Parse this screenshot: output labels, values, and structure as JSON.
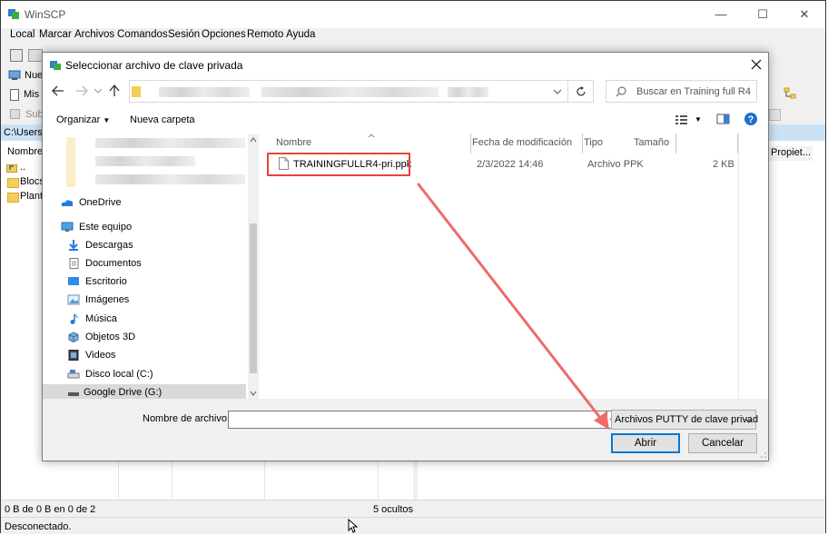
{
  "window": {
    "title": "WinSCP",
    "controls": {
      "minimize": "—",
      "maximize": "☐",
      "close": "✕"
    }
  },
  "menu": [
    "Local",
    "Marcar",
    "Archivos",
    "Comandos",
    "Sesión",
    "Opciones",
    "Remoto",
    "Ayuda"
  ],
  "left_toolbar": {
    "new_label": "Nue",
    "my_docs_label": "Mis d",
    "upload_label": "Subi"
  },
  "left_panel": {
    "path": "C:\\Users\\",
    "column_name": "Nombre",
    "items": [
      "..",
      "Blocs",
      "Planti"
    ]
  },
  "right_panel": {
    "properties_label": "Propiet..."
  },
  "status": {
    "selection": "0 B de 0 B en 0 de 2",
    "hidden": "5 ocultos",
    "connection": "Desconectado."
  },
  "dialog": {
    "title": "Seleccionar archivo de clave privada",
    "search_placeholder": "Buscar en Training full R4",
    "organize_label": "Organizar",
    "new_folder_label": "Nueva carpeta",
    "help_label": "?",
    "nav_items": [
      {
        "label": "OneDrive",
        "icon": "cloud-icon"
      },
      {
        "label": "Este equipo",
        "icon": "computer-icon"
      },
      {
        "label": "Descargas",
        "icon": "download-icon"
      },
      {
        "label": "Documentos",
        "icon": "documents-icon"
      },
      {
        "label": "Escritorio",
        "icon": "desktop-icon"
      },
      {
        "label": "Imágenes",
        "icon": "pictures-icon"
      },
      {
        "label": "Música",
        "icon": "music-icon"
      },
      {
        "label": "Objetos 3D",
        "icon": "objects3d-icon"
      },
      {
        "label": "Videos",
        "icon": "videos-icon"
      },
      {
        "label": "Disco local (C:)",
        "icon": "drive-icon"
      },
      {
        "label": "Google Drive (G:)",
        "icon": "gdrive-icon"
      }
    ],
    "columns": {
      "name": "Nombre",
      "modified": "Fecha de modificación",
      "type": "Tipo",
      "size": "Tamaño"
    },
    "files": [
      {
        "name": "TRAININGFULLR4-pri.ppk",
        "modified": "2/3/2022 14:46",
        "type": "Archivo PPK",
        "size": "2 KB"
      }
    ],
    "filename_label": "Nombre de archivo:",
    "filename_value": "",
    "filter_value": "Archivos PUTTY de clave privad",
    "open_label": "Abrir",
    "cancel_label": "Cancelar",
    "highlight_color": "#e8413c",
    "arrow_color": "#f06a6a"
  }
}
